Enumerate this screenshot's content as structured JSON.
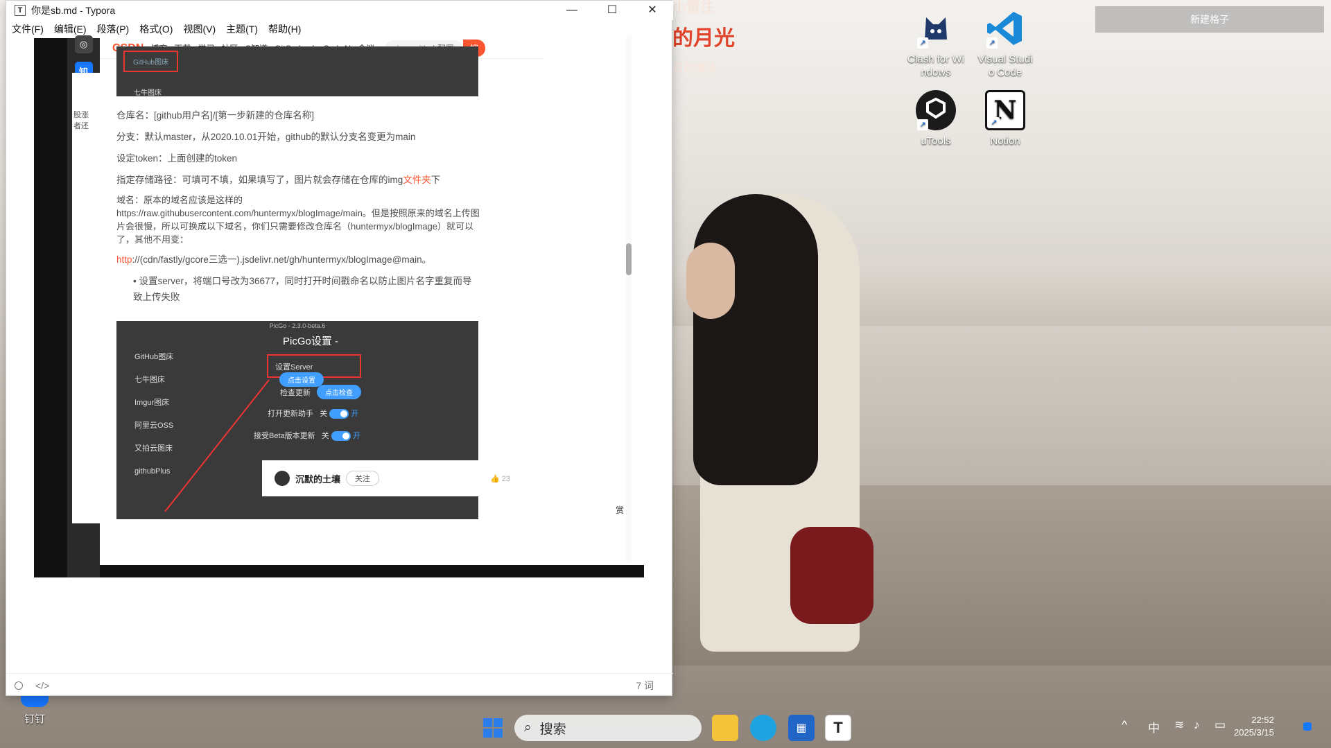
{
  "window": {
    "title": "你是sb.md - Typora",
    "min": "—",
    "max": "☐",
    "close": "✕"
  },
  "menu": [
    "文件(F)",
    "编辑(E)",
    "段落(P)",
    "格式(O)",
    "视图(V)",
    "主题(T)",
    "帮助(H)"
  ],
  "statusbar": {
    "word_count": "7 词",
    "source_toggle": "</>"
  },
  "browser": {
    "csdn_logo": "CSDN",
    "nav": [
      "博客",
      "下载",
      "学习",
      "社区",
      "C知道",
      "GitCode",
      "InsCodeAI",
      "会议"
    ],
    "search_text": "picgo github配置",
    "search_button": "搜"
  },
  "article": {
    "img1_items": [
      "GitHub图床",
      "七牛图床"
    ],
    "p_repo": "仓库名：[github用户名]/[第一步新建的仓库名称]",
    "p_branch": "分支：默认master，从2020.10.01开始，github的默认分支名变更为main",
    "p_token": "设定token：上面创建的token",
    "p_path_a": "指定存储路径：可填可不填，如果填写了，图片就会存储在仓库的img",
    "p_path_link": "文件夹",
    "p_path_b": "下",
    "p_domain": "域名：原本的域名应该是这样的https://raw.githubusercontent.com/huntermyx/blogImage/main。但是按照原来的域名上传图片会很慢，所以可换成以下域名，你们只需要修改仓库名（huntermyx/blogImage）就可以了，其他不用变：",
    "p_http_link": "http",
    "p_http_rest": "://(cdn/fastly/gcore三选一).jsdelivr.net/gh/huntermyx/blogImage@main。",
    "bullet": "设置server，将端口号改为36677，同时打开时间戳命名以防止图片名字重复而导致上传失败"
  },
  "picgo": {
    "version": "PicGo - 2.3.0-beta.6",
    "heading": "PicGo设置 - ",
    "sidebar": [
      "GitHub图床",
      "七牛图床",
      "Imgur图床",
      "阿里云OSS",
      "又拍云图床",
      "githubPlus"
    ],
    "rows": [
      {
        "label": "设置Server",
        "button": "点击设置"
      },
      {
        "label": "检查更新",
        "button": "点击检查"
      }
    ],
    "toggles": [
      {
        "label": "打开更新助手",
        "off": "关",
        "on": "开"
      },
      {
        "label": "接受Beta版本更新",
        "off": "关",
        "on": "开"
      }
    ]
  },
  "author": {
    "name": "沉默的土壤",
    "follow": "关注",
    "likes": "23",
    "reward": "赏"
  },
  "left_sidebar_snips": [
    "股涨",
    "者还"
  ],
  "desktop": {
    "new_grid": "新建格子",
    "icons": [
      {
        "label": "Clash for Windows",
        "line1": "Clash for Wi",
        "line2": "ndows",
        "name": "clash-icon"
      },
      {
        "label": "Visual Studio Code",
        "line1": "Visual Studi",
        "line2": "o Code",
        "name": "vscode-icon"
      },
      {
        "label": "uTools",
        "line1": "uTools",
        "line2": "",
        "name": "utools-icon"
      },
      {
        "label": "Notion",
        "line1": "Notion",
        "line2": "",
        "name": "notion-icon"
      }
    ],
    "dingtalk": "钉钉",
    "bg_text1": "的月光",
    "bg_text2": "小雷往",
    "bg_text3": "日的清洁"
  },
  "taskbar": {
    "search": "搜索",
    "ime": "中",
    "time": "22:52",
    "date": "2025/3/15"
  }
}
